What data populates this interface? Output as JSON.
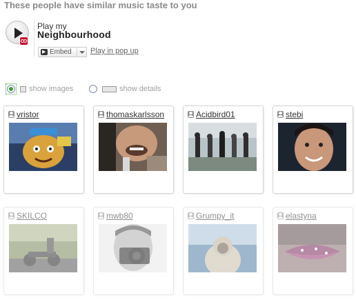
{
  "heading": "These people have similar music taste to you",
  "player": {
    "play_label": "Play my",
    "title": "Neighbourhood",
    "embed_label": "Embed",
    "popup_link": "Play in pop up"
  },
  "view_options": [
    {
      "label": "show images",
      "selected": true
    },
    {
      "label": "show details",
      "selected": false
    }
  ],
  "neighbours": [
    {
      "username": "vristor",
      "photo": "cartoon-character-avatar"
    },
    {
      "username": "thomaskarlsson",
      "photo": "laughing-man-with-drink"
    },
    {
      "username": "Acidbird01",
      "photo": "group-of-people-outdoors"
    },
    {
      "username": "stebi",
      "photo": "smiling-man-closeup"
    },
    {
      "username": "SKILCO",
      "photo": "motorcycle-street-scene"
    },
    {
      "username": "mwb80",
      "photo": "man-with-camera"
    },
    {
      "username": "Grumpy_it",
      "photo": "hooded-figure-at-sea"
    },
    {
      "username": "elastyna",
      "photo": "lips-closeup"
    }
  ],
  "colors": {
    "heading": "#8a8a8a",
    "lastfm_red": "#c8102e",
    "radio_selected": "#3aa13a"
  }
}
